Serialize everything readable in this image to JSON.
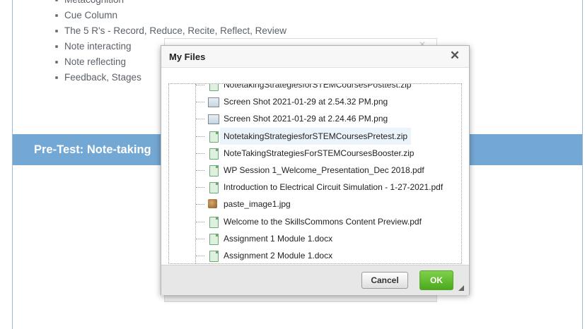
{
  "background_list": {
    "items": [
      "Metacognition",
      "Cue Column",
      "The 5 R's - Record, Reduce, Recite, Reflect, Review",
      "Note interacting",
      "Note reflecting",
      "Feedback, Stages"
    ]
  },
  "banner": {
    "title": "Pre-Test: Note-taking"
  },
  "dialog": {
    "title": "My Files",
    "close_symbol": "✕",
    "files": [
      {
        "name": "NotetakingStrategiesforSTEMCoursesPosttest.zip",
        "icon": "document-icon"
      },
      {
        "name": "Screen Shot 2021-01-29 at 2.54.32 PM.png",
        "icon": "image-icon"
      },
      {
        "name": "Screen Shot 2021-01-29 at 2.24.46 PM.png",
        "icon": "image-icon"
      },
      {
        "name": "NotetakingStrategiesforSTEMCoursesPretest.zip",
        "icon": "document-icon",
        "selected": true
      },
      {
        "name": "NoteTakingStrategiesForSTEMCoursesBooster.zip",
        "icon": "document-icon"
      },
      {
        "name": "WP Session 1_Welcome_Presentation_Dec 2018.pdf",
        "icon": "document-icon"
      },
      {
        "name": "Introduction to Electrical Circuit Simulation - 1-27-2021.pdf",
        "icon": "document-icon"
      },
      {
        "name": "paste_image1.jpg",
        "icon": "photo-icon"
      },
      {
        "name": "Welcome to the SkillsCommons Content Preview.pdf",
        "icon": "document-icon"
      },
      {
        "name": "Assignment 1 Module 1.docx",
        "icon": "document-icon"
      },
      {
        "name": "Assignment 2 Module 1.docx",
        "icon": "document-icon"
      }
    ],
    "cancel_label": "Cancel",
    "ok_label": "OK"
  }
}
